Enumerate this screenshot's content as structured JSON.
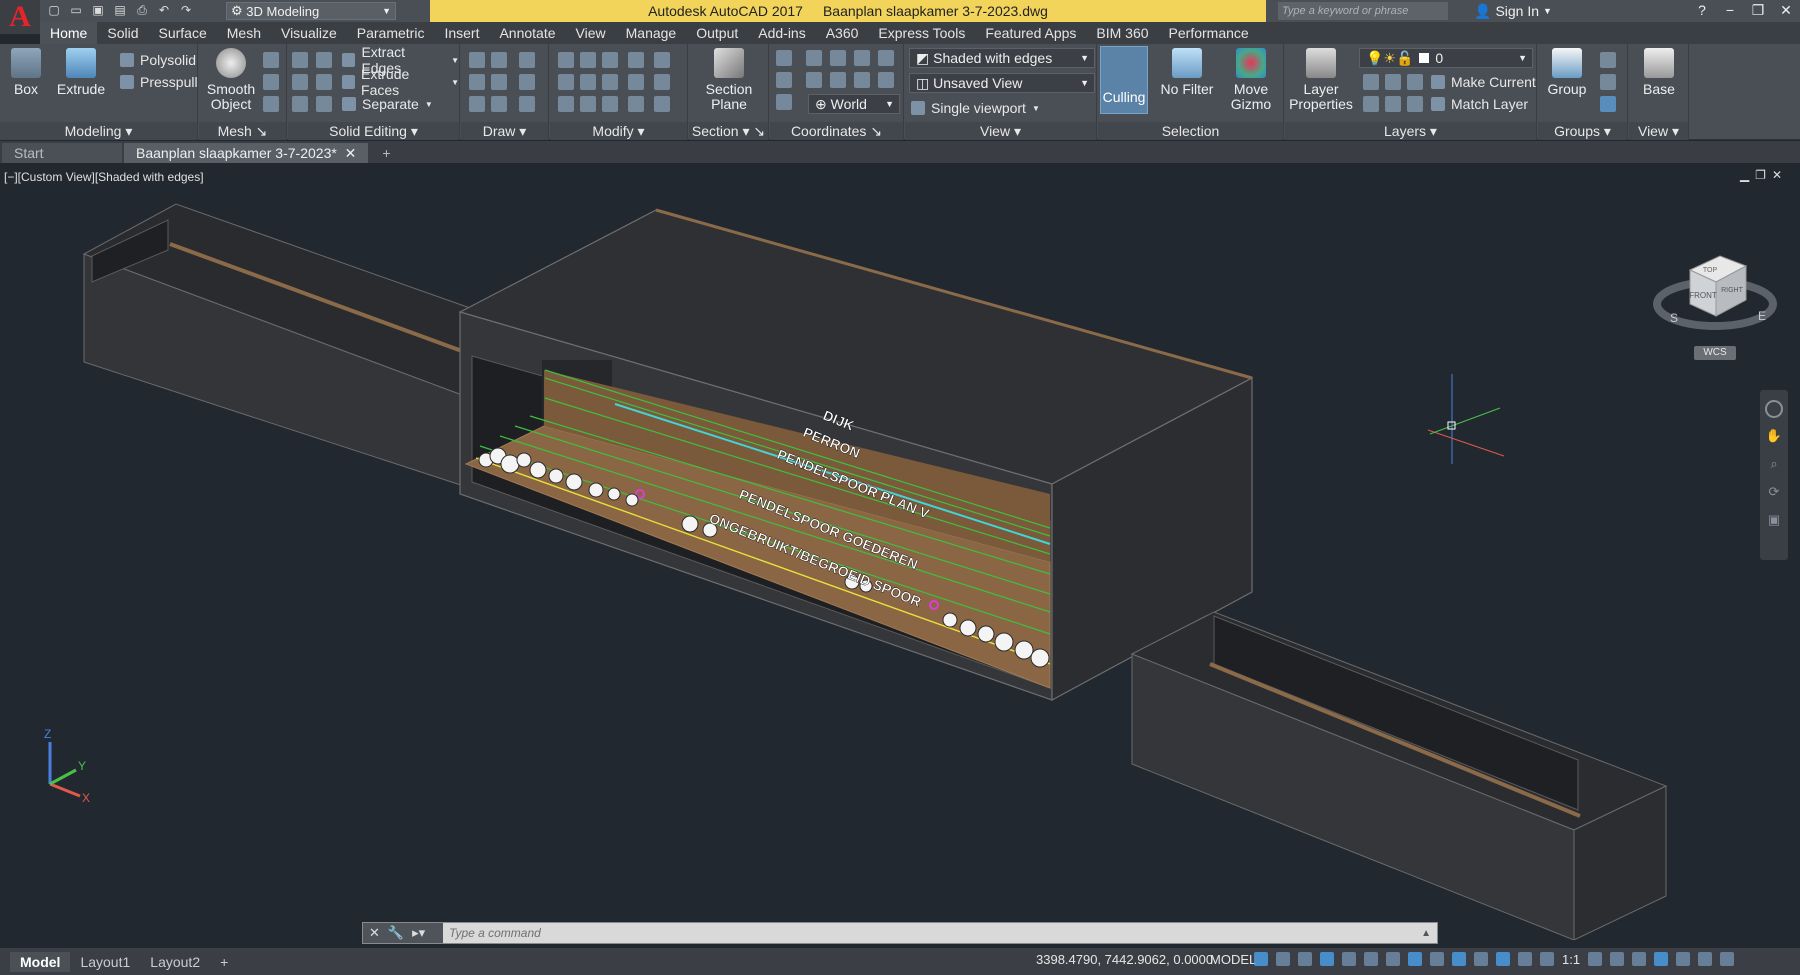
{
  "titlebar": {
    "app_title": "Autodesk AutoCAD 2017",
    "file_name": "Baanplan slaapkamer 3-7-2023.dwg",
    "workspace": "3D Modeling",
    "search_placeholder": "Type a keyword or phrase",
    "sign_in": "Sign In",
    "logo_letter": "A"
  },
  "menu_tabs": [
    "Home",
    "Solid",
    "Surface",
    "Mesh",
    "Visualize",
    "Parametric",
    "Insert",
    "Annotate",
    "View",
    "Manage",
    "Output",
    "Add-ins",
    "A360",
    "Express Tools",
    "Featured Apps",
    "BIM 360",
    "Performance"
  ],
  "ribbon": {
    "modeling": {
      "label": "Modeling",
      "box": "Box",
      "extrude": "Extrude",
      "polysolid": "Polysolid",
      "presspull": "Presspull"
    },
    "mesh": {
      "label": "Mesh",
      "smooth_object": "Smooth Object"
    },
    "solid_editing": {
      "label": "Solid Editing",
      "extract_edges": "Extract Edges",
      "extrude_faces": "Extrude Faces",
      "separate": "Separate"
    },
    "draw": {
      "label": "Draw"
    },
    "modify": {
      "label": "Modify"
    },
    "section": {
      "label": "Section",
      "section_plane": "Section Plane"
    },
    "coordinates": {
      "label": "Coordinates",
      "world": "World"
    },
    "view": {
      "label": "View",
      "visual_style": "Shaded with edges",
      "named_view": "Unsaved View",
      "viewport": "Single viewport"
    },
    "selection": {
      "label": "Selection",
      "culling": "Culling",
      "no_filter": "No Filter",
      "move_gizmo": "Move Gizmo"
    },
    "layers": {
      "label": "Layers",
      "layer_properties": "Layer Properties",
      "layer_name": "0",
      "make_current": "Make Current",
      "match_layer": "Match Layer"
    },
    "groups": {
      "label": "Groups",
      "group": "Group"
    },
    "view2": {
      "label": "View",
      "base": "Base"
    }
  },
  "doc_tabs": {
    "start": "Start",
    "drawing": "Baanplan slaapkamer 3-7-2023*"
  },
  "viewport": {
    "view_label": "[−][Custom View][Shaded with edges]",
    "track_labels": [
      "DIJK",
      "PERRON",
      "PENDELSPOOR PLAN V",
      "PENDELSPOOR GOEDEREN",
      "ONGEBRUIKT/BEGROEID SPOOR"
    ],
    "viewcube_top": "TOP",
    "viewcube_front": "FRONT",
    "viewcube_right": "RIGHT",
    "compass_s": "S",
    "compass_e": "E",
    "wcs": "WCS",
    "ucs_x": "X",
    "ucs_y": "Y",
    "ucs_z": "Z"
  },
  "command_line": {
    "placeholder": "Type a command"
  },
  "statusbar": {
    "layout_tabs": [
      "Model",
      "Layout1",
      "Layout2"
    ],
    "coordinates": "3398.4790, 7442.9062, 0.0000",
    "space": "MODEL",
    "scale": "1:1"
  },
  "colors": {
    "title_highlight": "#f2d45a",
    "viewport_bg": "#212830",
    "box_face": "#333438",
    "wood": "#7a5a3a",
    "track_green": "#3fbf3f",
    "track_cyan": "#3fd6d6",
    "track_yellow": "#e8e23a"
  }
}
